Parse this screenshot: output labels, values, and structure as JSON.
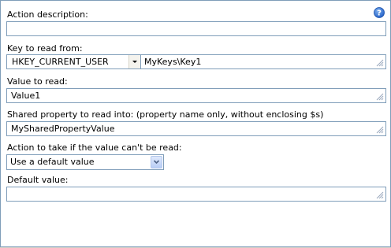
{
  "form": {
    "action_description": {
      "label": "Action description:",
      "value": ""
    },
    "key_to_read": {
      "label": "Key to read from:",
      "hive": "HKEY_CURRENT_USER",
      "path": "MyKeys\\Key1"
    },
    "value_to_read": {
      "label": "Value to read:",
      "value": "Value1"
    },
    "shared_property": {
      "label": "Shared property to read into: (property name only, without enclosing $s)",
      "value": "MySharedPropertyValue"
    },
    "failure_action": {
      "label": "Action to take if the value can't be read:",
      "selected": "Use a default value"
    },
    "default_value": {
      "label": "Default value:",
      "value": ""
    }
  },
  "icons": {
    "help": "help-icon",
    "resize_grip": "resize-grip-icon",
    "dropdown": "chevron-down-icon"
  },
  "colors": {
    "border": "#7f9db9",
    "help_blue": "#2f6fd0"
  }
}
